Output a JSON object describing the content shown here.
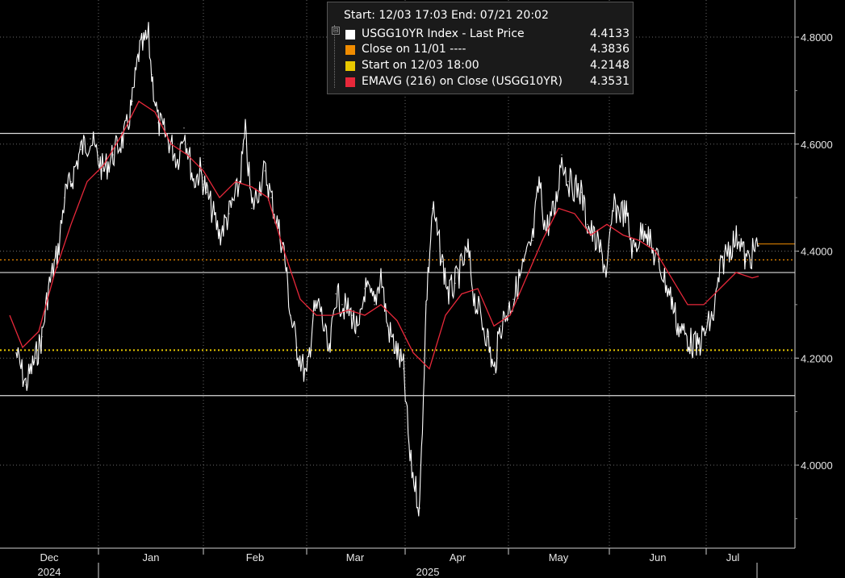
{
  "chart_data": {
    "type": "line",
    "y_ticks": [
      "4.8000",
      "4.6000",
      "4.4000",
      "4.2000",
      "4.0000"
    ],
    "y_tick_values": [
      4.8,
      4.6,
      4.4,
      4.2,
      4.0
    ],
    "ylim": [
      3.87,
      4.88
    ],
    "x_months": [
      "Dec",
      "Jan",
      "Feb",
      "Mar",
      "Apr",
      "May",
      "Jun",
      "Jul"
    ],
    "x_years": [
      "2024",
      "2025"
    ],
    "reference_lines": {
      "close_on_1101": 4.3836,
      "start_on_1203": 4.2148,
      "white_levels": [
        4.62,
        4.36,
        4.13
      ]
    },
    "series": [
      {
        "name": "USGG10YR Index - Last Price",
        "color": "#ffffff",
        "x": [
          "2024-12-03",
          "2024-12-06",
          "2024-12-09",
          "2024-12-11",
          "2024-12-13",
          "2024-12-16",
          "2024-12-18",
          "2024-12-20",
          "2024-12-23",
          "2024-12-26",
          "2024-12-30",
          "2025-01-02",
          "2025-01-06",
          "2025-01-08",
          "2025-01-10",
          "2025-01-13",
          "2025-01-14",
          "2025-01-16",
          "2025-01-20",
          "2025-01-22",
          "2025-01-24",
          "2025-01-27",
          "2025-01-29",
          "2025-01-31",
          "2025-02-04",
          "2025-02-07",
          "2025-02-10",
          "2025-02-12",
          "2025-02-14",
          "2025-02-18",
          "2025-02-20",
          "2025-02-24",
          "2025-02-26",
          "2025-02-28",
          "2025-03-03",
          "2025-03-05",
          "2025-03-07",
          "2025-03-10",
          "2025-03-12",
          "2025-03-14",
          "2025-03-17",
          "2025-03-19",
          "2025-03-21",
          "2025-03-24",
          "2025-03-26",
          "2025-03-28",
          "2025-03-31",
          "2025-04-02",
          "2025-04-04",
          "2025-04-07",
          "2025-04-09",
          "2025-04-11",
          "2025-04-14",
          "2025-04-16",
          "2025-04-18",
          "2025-04-22",
          "2025-04-24",
          "2025-04-28",
          "2025-04-30",
          "2025-05-02",
          "2025-05-06",
          "2025-05-08",
          "2025-05-12",
          "2025-05-14",
          "2025-05-16",
          "2025-05-19",
          "2025-05-21",
          "2025-05-23",
          "2025-05-27",
          "2025-05-29",
          "2025-06-02",
          "2025-06-04",
          "2025-06-06",
          "2025-06-10",
          "2025-06-12",
          "2025-06-16",
          "2025-06-18",
          "2025-06-20",
          "2025-06-24",
          "2025-06-26",
          "2025-06-30",
          "2025-07-02",
          "2025-07-07",
          "2025-07-09",
          "2025-07-11",
          "2025-07-15",
          "2025-07-17",
          "2025-07-21"
        ],
        "values": [
          4.21,
          4.15,
          4.2,
          4.24,
          4.33,
          4.4,
          4.5,
          4.53,
          4.59,
          4.61,
          4.55,
          4.58,
          4.62,
          4.68,
          4.77,
          4.8,
          4.73,
          4.64,
          4.6,
          4.57,
          4.63,
          4.53,
          4.55,
          4.51,
          4.43,
          4.47,
          4.52,
          4.62,
          4.48,
          4.55,
          4.5,
          4.4,
          4.28,
          4.22,
          4.16,
          4.28,
          4.3,
          4.2,
          4.32,
          4.3,
          4.28,
          4.24,
          4.33,
          4.3,
          4.36,
          4.26,
          4.21,
          4.18,
          4.01,
          3.92,
          4.3,
          4.48,
          4.38,
          4.32,
          4.34,
          4.4,
          4.31,
          4.24,
          4.17,
          4.26,
          4.31,
          4.35,
          4.42,
          4.53,
          4.44,
          4.48,
          4.58,
          4.53,
          4.51,
          4.45,
          4.4,
          4.36,
          4.48,
          4.47,
          4.4,
          4.45,
          4.4,
          4.38,
          4.31,
          4.26,
          4.23,
          4.22,
          4.28,
          4.36,
          4.4,
          4.43,
          4.38,
          4.41
        ]
      },
      {
        "name": "EMAVG (216) on Close (USGG10YR)",
        "color": "#e8283a",
        "x": [
          "2024-12-01",
          "2024-12-05",
          "2024-12-10",
          "2024-12-15",
          "2024-12-20",
          "2024-12-25",
          "2024-12-30",
          "2025-01-05",
          "2025-01-10",
          "2025-01-15",
          "2025-01-20",
          "2025-01-25",
          "2025-01-30",
          "2025-02-04",
          "2025-02-09",
          "2025-02-14",
          "2025-02-19",
          "2025-02-24",
          "2025-03-01",
          "2025-03-06",
          "2025-03-11",
          "2025-03-16",
          "2025-03-21",
          "2025-03-26",
          "2025-03-31",
          "2025-04-05",
          "2025-04-10",
          "2025-04-15",
          "2025-04-20",
          "2025-04-25",
          "2025-04-30",
          "2025-05-05",
          "2025-05-10",
          "2025-05-15",
          "2025-05-20",
          "2025-05-25",
          "2025-05-30",
          "2025-06-04",
          "2025-06-09",
          "2025-06-14",
          "2025-06-19",
          "2025-06-24",
          "2025-06-29",
          "2025-07-04",
          "2025-07-09",
          "2025-07-14",
          "2025-07-19",
          "2025-07-21"
        ],
        "values": [
          4.28,
          4.22,
          4.25,
          4.36,
          4.45,
          4.53,
          4.56,
          4.62,
          4.68,
          4.66,
          4.6,
          4.58,
          4.55,
          4.5,
          4.53,
          4.52,
          4.5,
          4.4,
          4.31,
          4.28,
          4.28,
          4.29,
          4.28,
          4.3,
          4.27,
          4.21,
          4.18,
          4.28,
          4.32,
          4.33,
          4.26,
          4.28,
          4.35,
          4.42,
          4.48,
          4.47,
          4.43,
          4.45,
          4.43,
          4.42,
          4.4,
          4.35,
          4.3,
          4.3,
          4.33,
          4.36,
          4.35,
          4.3531
        ]
      }
    ]
  },
  "legend": {
    "header": "Start: 12/03 17:03 End: 07/21 20:02",
    "collapse_glyph": "⊟",
    "rows": [
      {
        "label": "USGG10YR Index - Last Price",
        "value": "4.4133",
        "color": "#ffffff"
      },
      {
        "label": "Close on 11/01 ----",
        "value": "4.3836",
        "color": "#f08c00"
      },
      {
        "label": "Start on 12/03 18:00",
        "value": "4.2148",
        "color": "#e8c800"
      },
      {
        "label": "EMAVG (216)  on Close (USGG10YR)",
        "value": "4.3531",
        "color": "#e8283a"
      }
    ]
  }
}
